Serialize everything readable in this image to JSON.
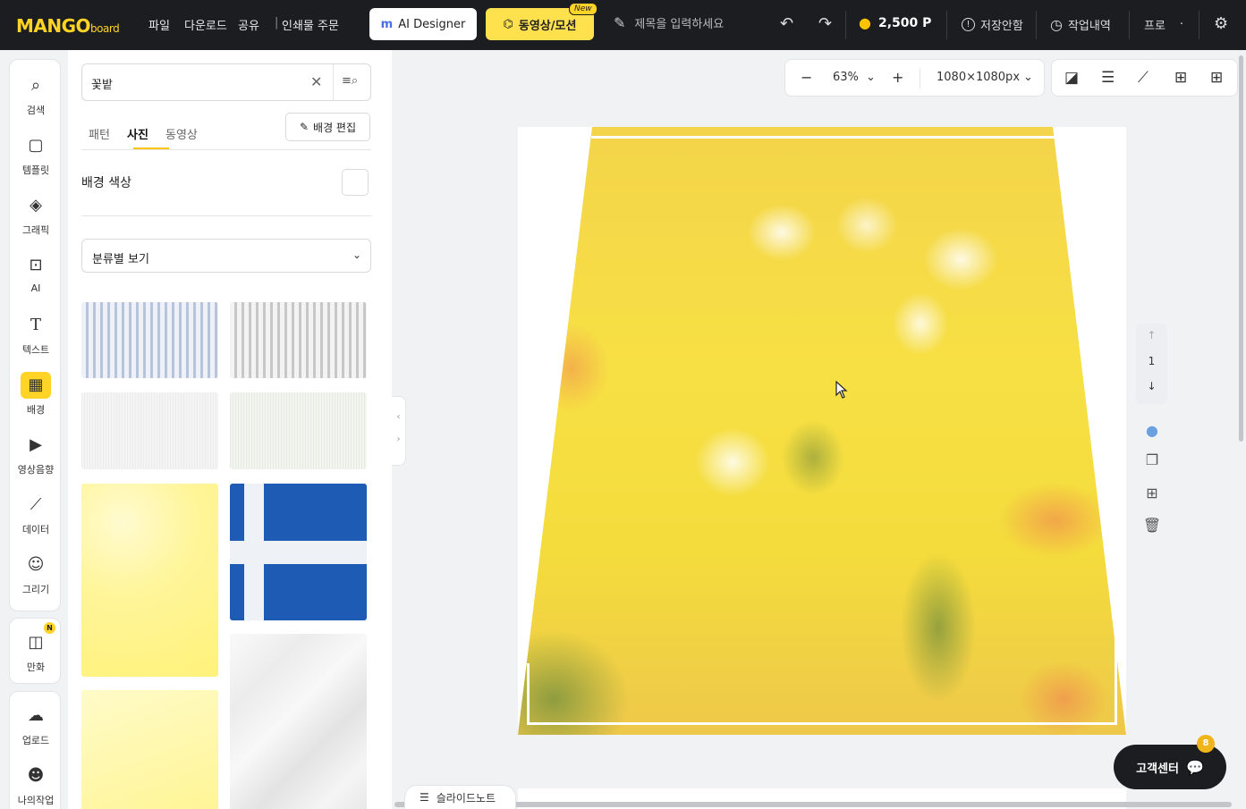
{
  "header": {
    "logo_main": "MANGO",
    "logo_sub": "board",
    "menu": {
      "file": "파일",
      "download": "다운로드",
      "share": "공유",
      "print": "인쇄물 주문"
    },
    "ai_designer": "AI Designer",
    "video_motion": "동영상/모션",
    "new_badge": "New",
    "title_placeholder": "제목을 입력하세요",
    "points": "2,500 P",
    "save_status": "저장안함",
    "history": "작업내역",
    "pro": "프로",
    "pro_dot": "·"
  },
  "nav": {
    "items": [
      {
        "label": "검색",
        "icon": "search-icon"
      },
      {
        "label": "템플릿",
        "icon": "template-icon"
      },
      {
        "label": "그래픽",
        "icon": "graphic-icon"
      },
      {
        "label": "AI",
        "icon": "ai-chip-icon"
      },
      {
        "label": "텍스트",
        "icon": "text-icon"
      },
      {
        "label": "배경",
        "icon": "background-icon",
        "active": true
      },
      {
        "label": "영상음향",
        "icon": "video-audio-icon"
      },
      {
        "label": "데이터",
        "icon": "chart-icon"
      },
      {
        "label": "그리기",
        "icon": "draw-icon"
      }
    ],
    "comic": {
      "label": "만화",
      "badge": "N"
    },
    "upload": {
      "label": "업로드"
    },
    "my_work": {
      "label": "나의작업"
    }
  },
  "panel": {
    "search_value": "꽃밭",
    "tabs": [
      "패턴",
      "사진",
      "동영상"
    ],
    "active_tab": "사진",
    "bg_edit": "배경 편집",
    "bg_color_label": "배경 색상",
    "category_select": "분류별 보기"
  },
  "canvas": {
    "zoom": "63%",
    "size": "1080×1080px",
    "page_number": "1"
  },
  "footer": {
    "slide_note": "슬라이드노트",
    "help": "고객센터",
    "help_badge": "8"
  }
}
